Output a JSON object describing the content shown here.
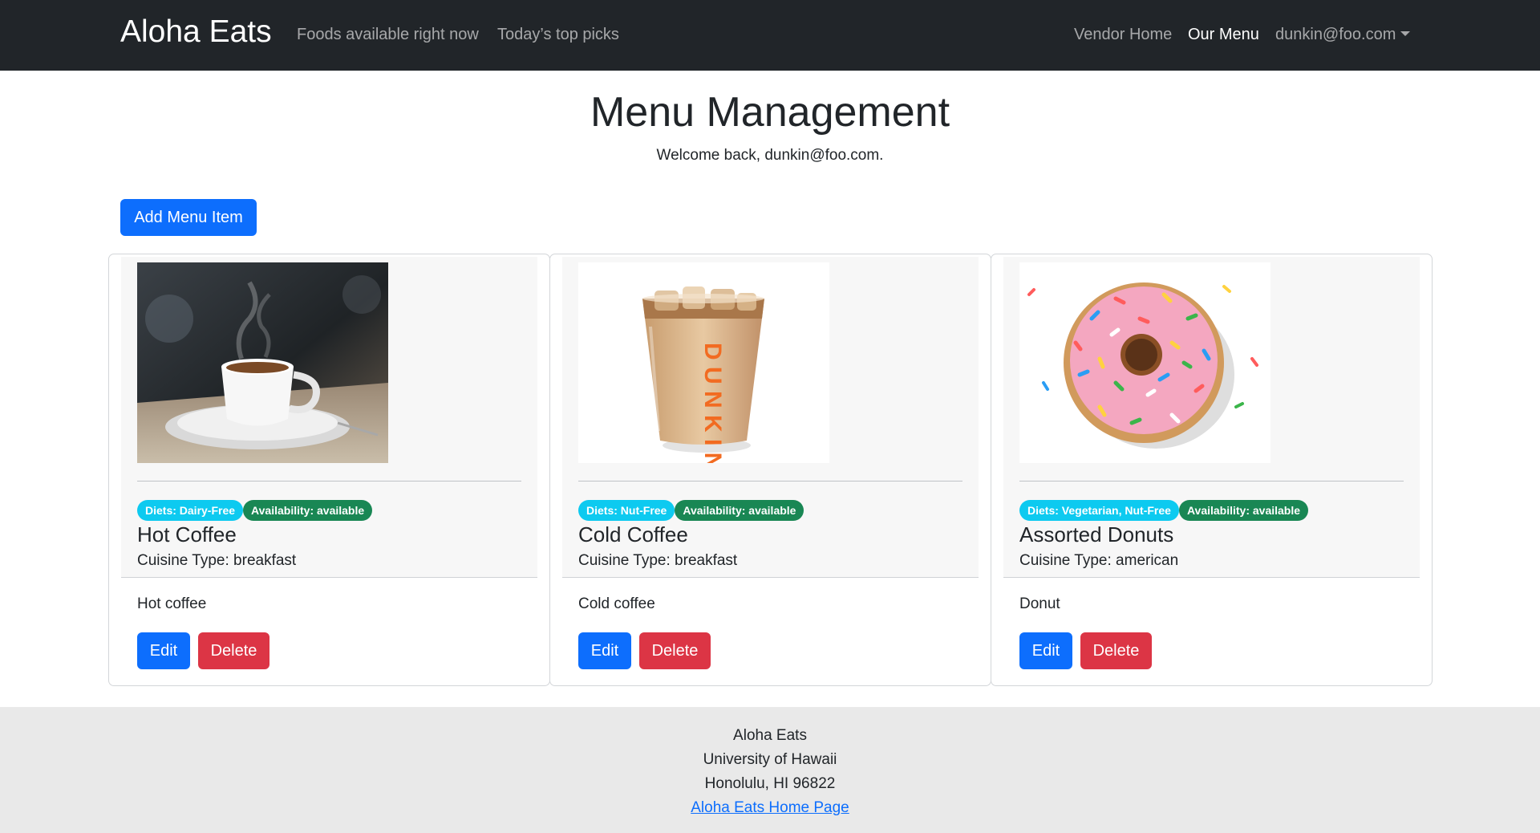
{
  "navbar": {
    "brand": "Aloha Eats",
    "links": [
      "Foods available right now",
      "Today’s top picks"
    ],
    "right_links": [
      "Vendor Home",
      "Our Menu"
    ],
    "user": "dunkin@foo.com",
    "active": "Our Menu"
  },
  "header": {
    "title": "Menu Management",
    "welcome": "Welcome back, dunkin@foo.com."
  },
  "toolbar": {
    "add_label": "Add Menu Item"
  },
  "cards": [
    {
      "image": "hot-coffee-cup-image",
      "diets": "Diets: Dairy-Free",
      "availability": "Availability: available",
      "title": "Hot Coffee",
      "cuisine": "Cuisine Type: breakfast",
      "description": "Hot coffee",
      "edit_label": "Edit",
      "delete_label": "Delete"
    },
    {
      "image": "iced-coffee-cup-image",
      "diets": "Diets: Nut-Free",
      "availability": "Availability: available",
      "title": "Cold Coffee",
      "cuisine": "Cuisine Type: breakfast",
      "description": "Cold coffee",
      "edit_label": "Edit",
      "delete_label": "Delete"
    },
    {
      "image": "sprinkled-donut-image",
      "diets": "Diets: Vegetarian, Nut-Free",
      "availability": "Availability: available",
      "title": "Assorted Donuts",
      "cuisine": "Cuisine Type: american",
      "description": "Donut",
      "edit_label": "Edit",
      "delete_label": "Delete"
    }
  ],
  "footer": {
    "lines": [
      "Aloha Eats",
      "University of Hawaii",
      "Honolulu, HI 96822"
    ],
    "link": "Aloha Eats Home Page"
  },
  "colors": {
    "navbar_bg": "#212529",
    "primary": "#0d6efd",
    "danger": "#dc3545",
    "info": "#0dcaf0",
    "success": "#198754",
    "footer_bg": "#e9e9e9"
  }
}
